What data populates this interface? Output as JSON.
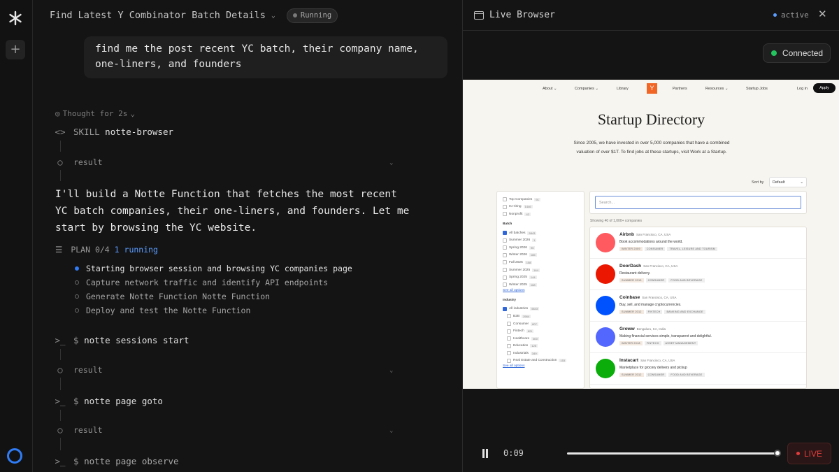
{
  "header": {
    "title": "Find Latest Y Combinator Batch Details",
    "status": "Running"
  },
  "user_message": "find me the post recent YC batch, their company name, one-liners, and founders",
  "thought": "Thought for 2s",
  "skill": {
    "tag": "SKILL",
    "name": "notte-browser"
  },
  "result_label": "result",
  "assistant_text": "I'll build a Notte Function that fetches the most recent YC batch companies, their one-liners, and founders. Let me start by browsing the YC website.",
  "plan": {
    "label": "PLAN",
    "progress": "0/4",
    "running": "1 running",
    "items": [
      "Starting browser session and browsing YC companies page",
      "Capture network traffic and identify API endpoints",
      "Generate Notte Function Notte Function",
      "Deploy and test the Notte Function"
    ]
  },
  "commands": [
    {
      "prompt": "$",
      "text": "notte sessions start"
    },
    {
      "prompt": "$",
      "text": "notte page goto"
    },
    {
      "prompt": "$",
      "text": "notte page observe"
    }
  ],
  "browser": {
    "title": "Live Browser",
    "state": "active",
    "connection": "Connected",
    "time": "0:09",
    "live": "LIVE",
    "playback_progress": 0.99,
    "page": {
      "nav": [
        "About ⌄",
        "Companies ⌄",
        "Library",
        "Partners",
        "Resources ⌄",
        "Startup Jobs",
        "Log in"
      ],
      "logo": "Y",
      "apply": "Apply",
      "title": "Startup Directory",
      "sub_line1": "Since 2005, we have invested in over 5,000 companies that have a combined",
      "sub_line2": "valuation of over $1T. To find jobs at these startups, visit Work at a Startup.",
      "sort_label": "Sort by",
      "sort_value": "Default",
      "search_placeholder": "Search...",
      "showing": "Showing 40 of 1,000+ companies",
      "filters": {
        "top": [
          [
            "Top Companies",
            "91"
          ],
          [
            "Is Hiring",
            "1446"
          ],
          [
            "Nonprofit",
            "42"
          ]
        ],
        "batch_title": "Batch",
        "batch": [
          [
            "All batches",
            "5843",
            true
          ],
          [
            "Summer 2026",
            "1",
            false
          ],
          [
            "Spring 2026",
            "95",
            false
          ],
          [
            "Winter 2026",
            "186",
            false
          ],
          [
            "Fall 2025",
            "158",
            false
          ],
          [
            "Summer 2025",
            "164",
            false
          ],
          [
            "Spring 2025",
            "144",
            false
          ],
          [
            "Winter 2025",
            "168",
            false
          ]
        ],
        "see_all": "See all options",
        "industry_title": "Industry",
        "industry": [
          [
            "All industries",
            "5843",
            true
          ],
          [
            "B2B",
            "2984",
            false
          ],
          [
            "Consumer",
            "807",
            false
          ],
          [
            "Fintech",
            "621",
            false
          ],
          [
            "Healthcare",
            "600",
            false
          ],
          [
            "Education",
            "125",
            false
          ],
          [
            "Industrials",
            "349",
            false
          ],
          [
            "Real Estate and Construction",
            "153",
            false
          ]
        ]
      },
      "companies": [
        {
          "name": "Airbnb",
          "loc": "San Francisco, CA, USA",
          "desc": "Book accommodations around the world.",
          "tags": [
            "WINTER 2009",
            "CONSUMER",
            "TRAVEL, LEISURE AND TOURISM"
          ],
          "color": "#ff5a5f"
        },
        {
          "name": "DoorDash",
          "loc": "San Francisco, CA, USA",
          "desc": "Restaurant delivery.",
          "tags": [
            "SUMMER 2013",
            "CONSUMER",
            "FOOD AND BEVERAGE"
          ],
          "color": "#eb1700"
        },
        {
          "name": "Coinbase",
          "loc": "San Francisco, CA, USA",
          "desc": "Buy, sell, and manage cryptocurrencies.",
          "tags": [
            "SUMMER 2012",
            "FINTECH",
            "BANKING AND EXCHANGE"
          ],
          "color": "#0052ff"
        },
        {
          "name": "Groww",
          "loc": "Bengaluru, KA, India",
          "desc": "Making financial services simple, transparent and delightful.",
          "tags": [
            "WINTER 2018",
            "FINTECH",
            "ASSET MANAGEMENT"
          ],
          "color": "#5367ff"
        },
        {
          "name": "Instacart",
          "loc": "San Francisco, CA, USA",
          "desc": "Marketplace for grocery delivery and pickup",
          "tags": [
            "SUMMER 2012",
            "CONSUMER",
            "FOOD AND BEVERAGE"
          ],
          "color": "#0aad0a"
        }
      ]
    }
  }
}
